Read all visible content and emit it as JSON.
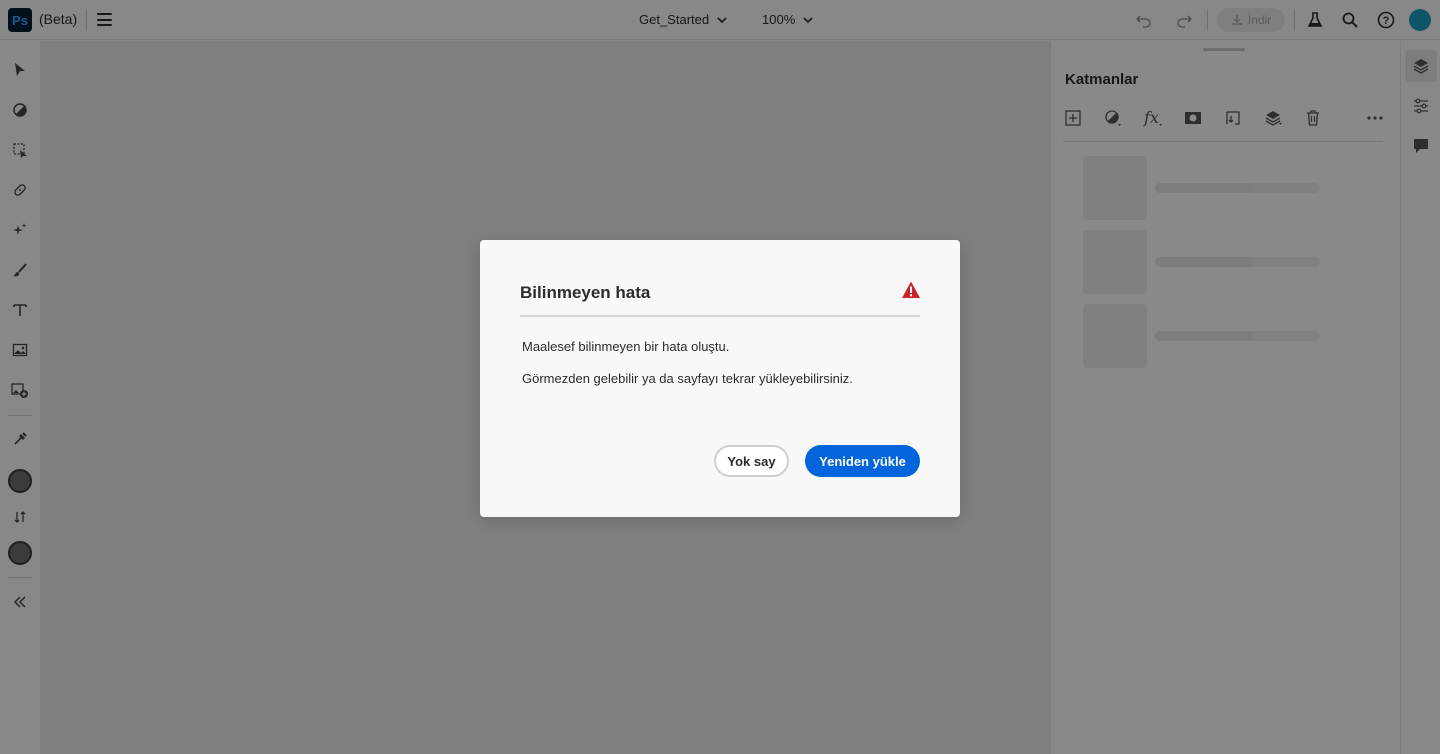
{
  "app": {
    "logo_text": "Ps",
    "beta_label": "(Beta)"
  },
  "header": {
    "document_name": "Get_Started",
    "zoom_level": "100%",
    "download_label": "İndir"
  },
  "icons": {
    "undo": "undo-icon",
    "redo": "redo-icon",
    "labs": "flask-icon",
    "search": "search-icon",
    "help": "help-icon"
  },
  "layers_panel": {
    "title": "Katmanlar",
    "placeholder_rows": 3
  },
  "dialog": {
    "title": "Bilinmeyen hata",
    "message_line1": "Maalesef bilinmeyen bir hata oluştu.",
    "message_line2": "Görmezden gelebilir ya da sayfayı tekrar yükleyebilirsiniz.",
    "ignore_label": "Yok say",
    "reload_label": "Yeniden yükle"
  },
  "colors": {
    "accent": "#0265dc",
    "alert": "#c9252d",
    "avatar": "#1a9bbd"
  }
}
